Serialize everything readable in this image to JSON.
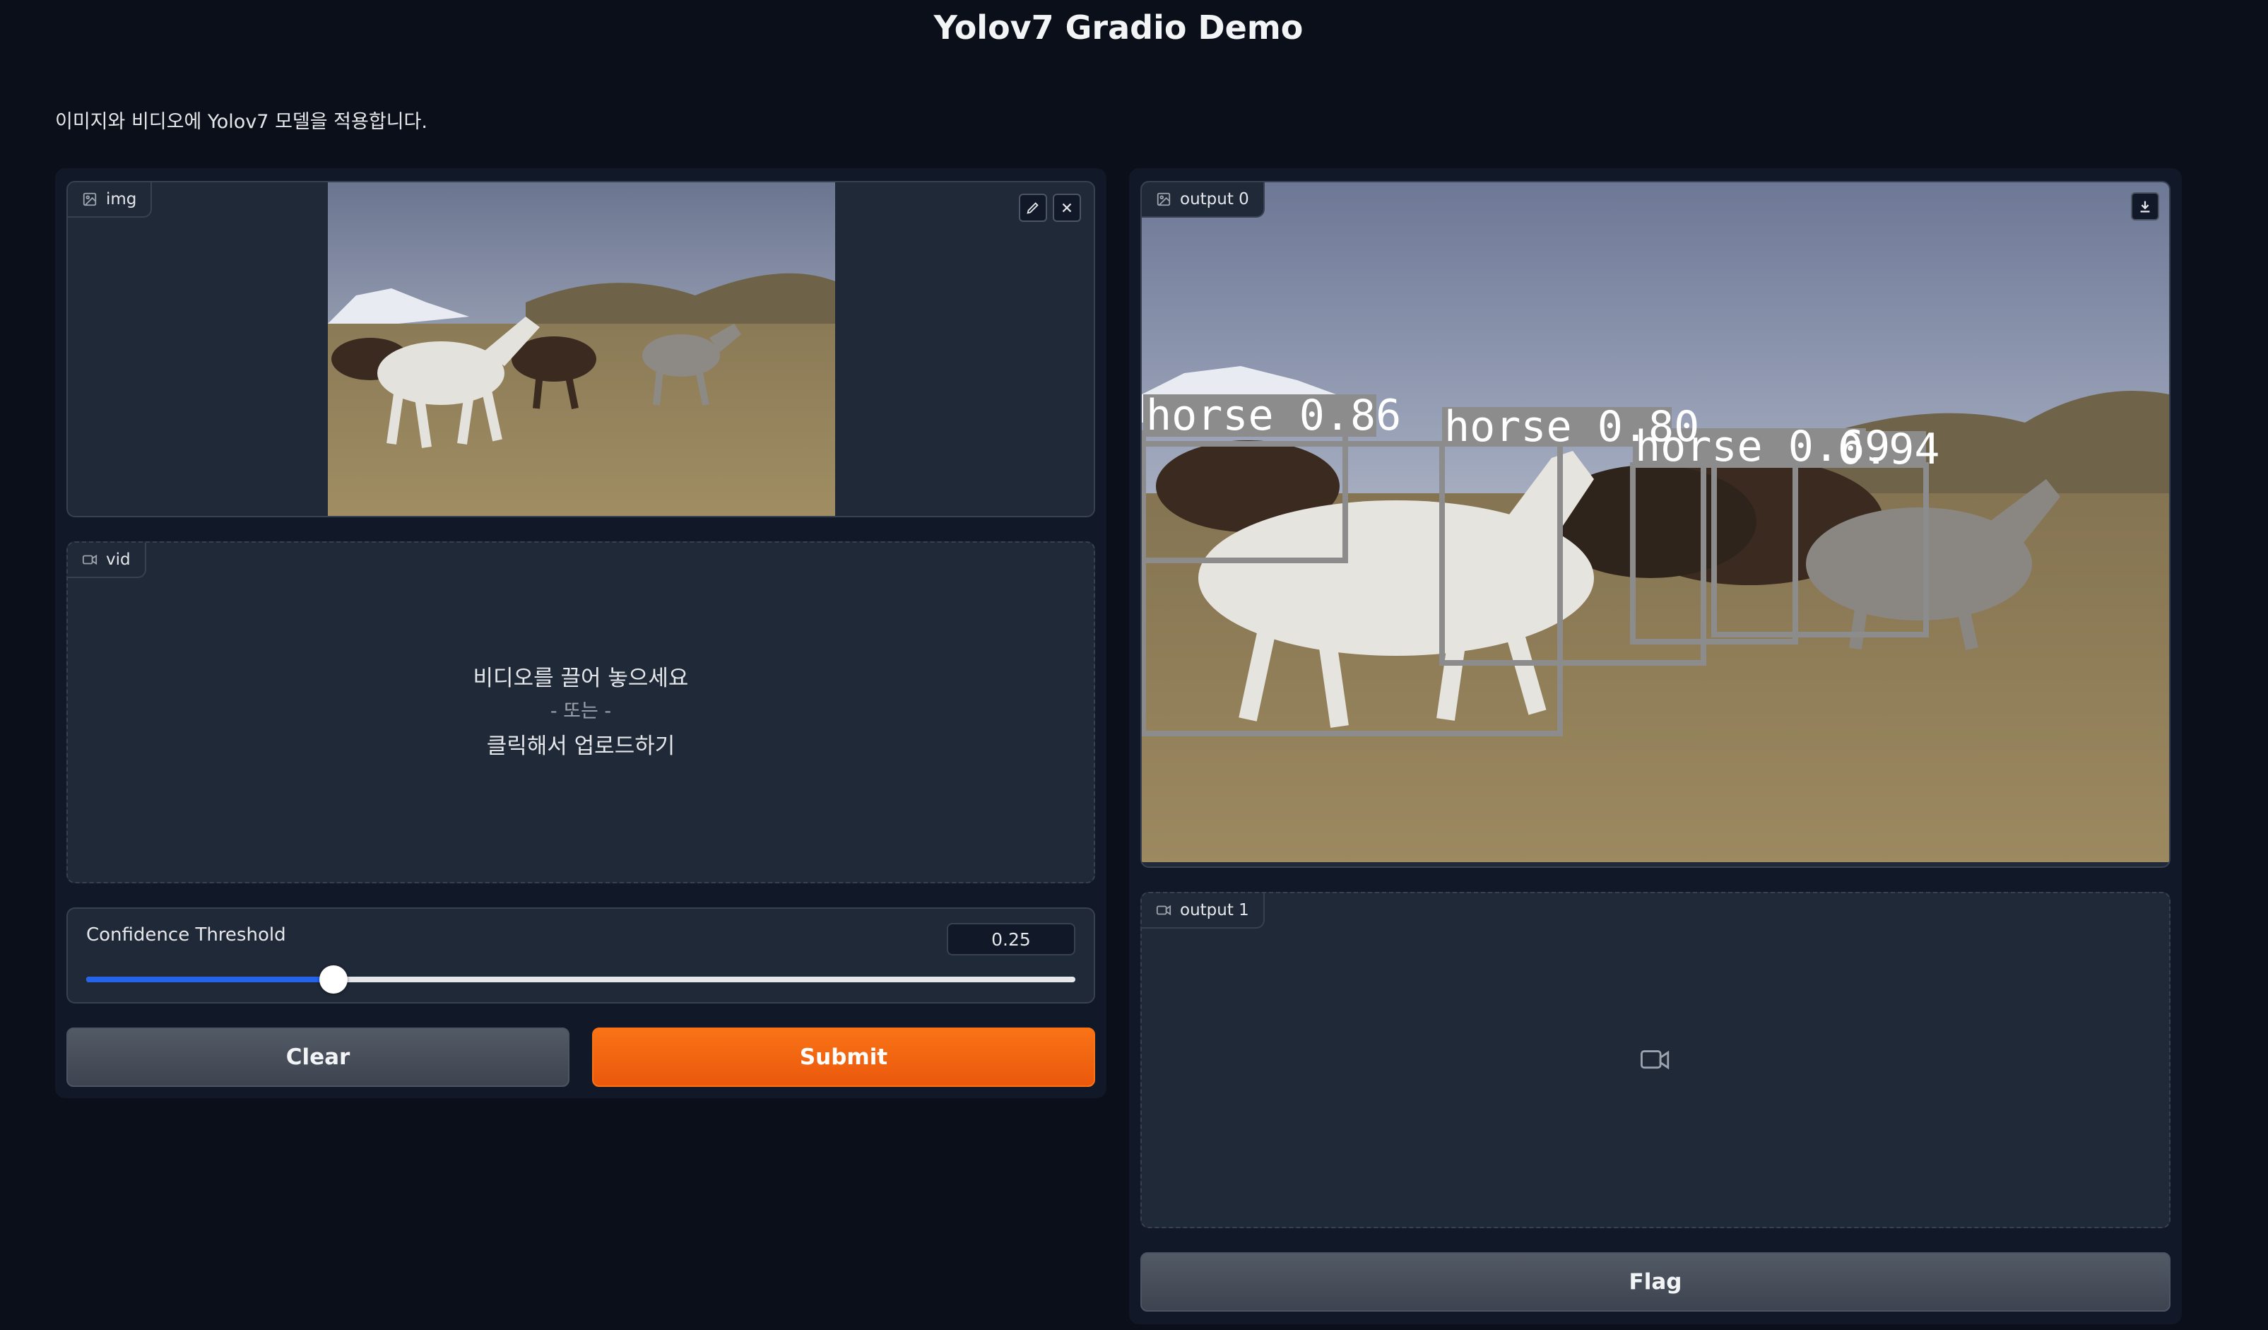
{
  "header": {
    "title": "Yolov7 Gradio Demo",
    "description": "이미지와 비디오에 Yolov7 모델을 적용합니다."
  },
  "inputs": {
    "image": {
      "label": "img",
      "icons": [
        "image-icon",
        "edit-icon",
        "close-icon"
      ]
    },
    "video": {
      "label": "vid",
      "drop_text": "비디오를 끌어 놓으세요",
      "or_text": "- 또는 -",
      "click_text": "클릭해서 업로드하기"
    },
    "slider": {
      "label": "Confidence Threshold",
      "value": "0.25",
      "fraction": 0.25
    }
  },
  "buttons": {
    "clear": "Clear",
    "submit": "Submit",
    "flag": "Flag"
  },
  "outputs": {
    "image": {
      "label": "output 0",
      "detections": [
        {
          "label": "horse 0.86"
        },
        {
          "label": "horse 0.80"
        },
        {
          "label": "horse 0.69"
        },
        {
          "label": "0.94"
        }
      ]
    },
    "video": {
      "label": "output 1",
      "icon": "video-icon"
    }
  },
  "colors": {
    "background": "#0b0f19",
    "panel": "#111827",
    "block": "#1f2937",
    "accent": "#f97316",
    "slider": "#2563eb"
  }
}
